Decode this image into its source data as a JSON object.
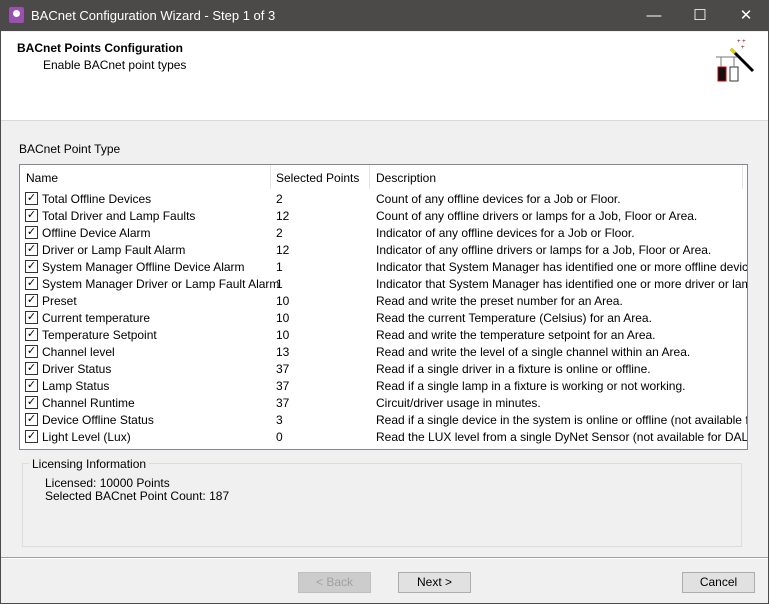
{
  "window": {
    "title": "BACnet Configuration Wizard - Step 1 of 3",
    "minimize": "—",
    "maximize": "☐",
    "close": "✕"
  },
  "header": {
    "title": "BACnet Points Configuration",
    "subtitle": "Enable BACnet point types"
  },
  "section_label": "BACnet Point Type",
  "table": {
    "columns": [
      "Name",
      "Selected Points",
      "Description"
    ],
    "rows": [
      {
        "checked": true,
        "name": "Total Offline Devices",
        "points": "2",
        "description": "Count of any offline devices for a Job or Floor."
      },
      {
        "checked": true,
        "name": "Total Driver and Lamp Faults",
        "points": "12",
        "description": "Count of any offline drivers or lamps for a Job, Floor or Area."
      },
      {
        "checked": true,
        "name": "Offline Device Alarm",
        "points": "2",
        "description": "Indicator of any offline devices for a Job or Floor."
      },
      {
        "checked": true,
        "name": "Driver or Lamp Fault Alarm",
        "points": "12",
        "description": "Indicator of any offline drivers or lamps for a Job, Floor or Area."
      },
      {
        "checked": true,
        "name": "System Manager Offline Device Alarm",
        "points": "1",
        "description": "Indicator that System Manager has identified one or more offline devices."
      },
      {
        "checked": true,
        "name": "System Manager Driver or Lamp Fault Alarm",
        "points": "1",
        "description": "Indicator that System Manager has identified one or more driver or lamp fail..."
      },
      {
        "checked": true,
        "name": "Preset",
        "points": "10",
        "description": "Read and write the preset number for an Area."
      },
      {
        "checked": true,
        "name": "Current temperature",
        "points": "10",
        "description": "Read the current Temperature (Celsius) for an Area."
      },
      {
        "checked": true,
        "name": "Temperature Setpoint",
        "points": "10",
        "description": "Read and write the temperature setpoint for an Area."
      },
      {
        "checked": true,
        "name": "Channel level",
        "points": "13",
        "description": "Read and write the level of a single channel within an Area."
      },
      {
        "checked": true,
        "name": "Driver Status",
        "points": "37",
        "description": "Read if a single driver in a fixture is online or offline."
      },
      {
        "checked": true,
        "name": "Lamp Status",
        "points": "37",
        "description": "Read if a single lamp in a fixture is working or not working."
      },
      {
        "checked": true,
        "name": "Channel Runtime",
        "points": "37",
        "description": "Circuit/driver usage in minutes."
      },
      {
        "checked": true,
        "name": "Device Offline Status",
        "points": "3",
        "description": "Read if a single device in the system is online or offline (not available for D..."
      },
      {
        "checked": true,
        "name": "Light Level (Lux)",
        "points": "0",
        "description": "Read the LUX level from a single DyNet Sensor (not available for DALI sen..."
      }
    ]
  },
  "licensing": {
    "title": "Licensing Information",
    "licensed": "Licensed: 10000 Points",
    "selected": "Selected BACnet Point Count: 187"
  },
  "buttons": {
    "back": "< Back",
    "next": "Next >",
    "cancel": "Cancel"
  }
}
